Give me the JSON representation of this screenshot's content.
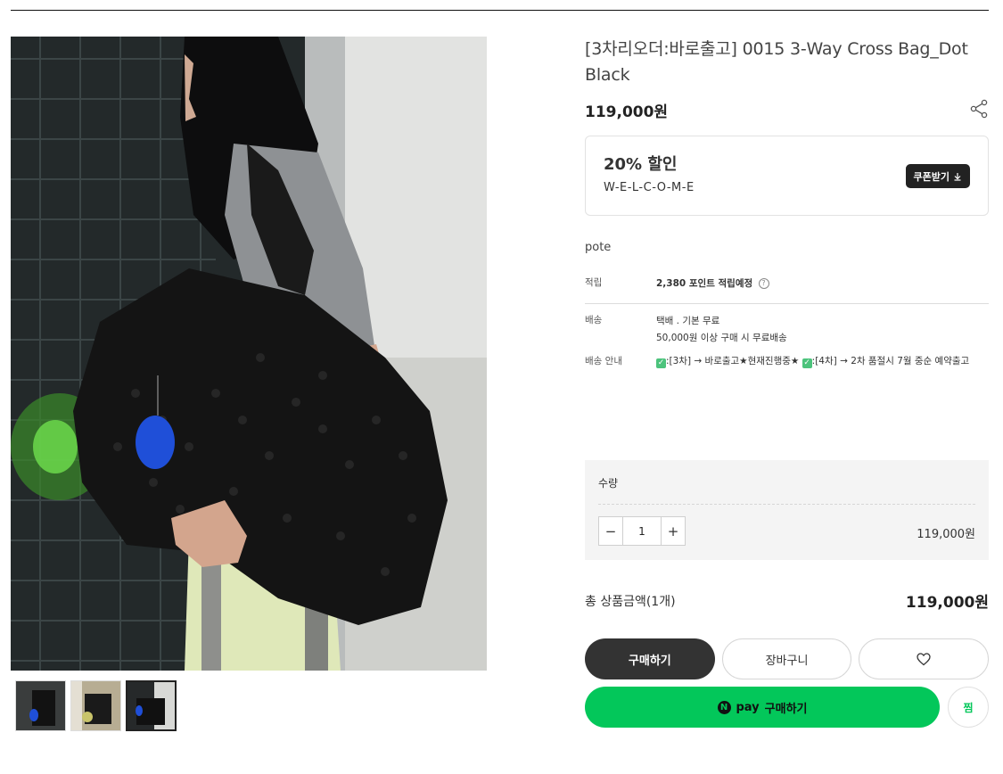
{
  "product": {
    "title": "[3차리오더:바로출고] 0015 3-Way Cross Bag_Dot Black",
    "price": "119,000원",
    "brand": "pote"
  },
  "coupon": {
    "percent": "20% 할인",
    "code": "W-E-L-C-O-M-E",
    "button_label": "쿠폰받기"
  },
  "info": {
    "points_key": "적립",
    "points_val": "2,380 포인트 적립예정",
    "shipping_key": "배송",
    "shipping_val1": "택배 . 기본 무료",
    "shipping_val2": "50,000원 이상 구매 시 무료배송",
    "notice_key": "배송 안내",
    "notice_part1": ":[3차] → 바로출고★현재진행중★ ",
    "notice_part2": ":[4차] → 2차 품절시 7월 중순 예약출고"
  },
  "quantity": {
    "label": "수량",
    "value": "1",
    "minus": "−",
    "plus": "+",
    "line_price": "119,000원"
  },
  "total": {
    "label": "총 상품금액(1개)",
    "price": "119,000원"
  },
  "buttons": {
    "buy": "구매하기",
    "cart": "장바구니",
    "npay_n": "N",
    "npay_brand": "pay",
    "npay_buy": "구매하기",
    "zzim": "찜"
  },
  "colors": {
    "npay_green": "#03c75a",
    "dark_button": "#333333"
  }
}
